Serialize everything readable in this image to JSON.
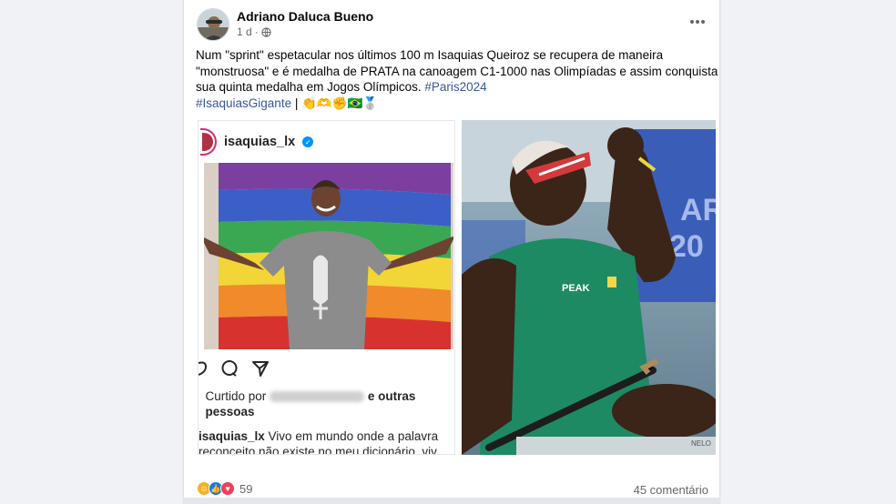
{
  "post": {
    "author": "Adriano Daluca Bueno",
    "time": "1 d",
    "separator": "·",
    "privacy_icon": "globe-icon",
    "text_lines": [
      "Num \"sprint\" espetacular nos últimos 100 m Isaquias Queiroz se recupera de maneira",
      "\"monstruosa\" e é medalha de PRATA na canoagem  C1-1000 nas Olimpíadas e assim conquista",
      "sua quinta medalha em Jogos Olímpicos. "
    ],
    "hashtag_inline": "#Paris2024",
    "hashtag_line": "#IsaquiasGigante",
    "emoji_suffix": " | 👏🫶✊🇧🇷🥈"
  },
  "instagram": {
    "username": "isaquias_lx",
    "liked_prefix": "Curtido por",
    "liked_suffix": "e outras",
    "liked_line2": "pessoas",
    "caption_user": "isaquias_lx",
    "caption_line1": " Vivo em mundo onde a palavra",
    "caption_line2": "reconceito não existe no meu dicionário. viv"
  },
  "footer": {
    "reaction_count": "59",
    "comments": "45 comentário"
  },
  "colors": {
    "link": "#385898",
    "facebook_blue": "#1877f2",
    "love_red": "#f33e58",
    "care_yellow": "#f7b125"
  }
}
